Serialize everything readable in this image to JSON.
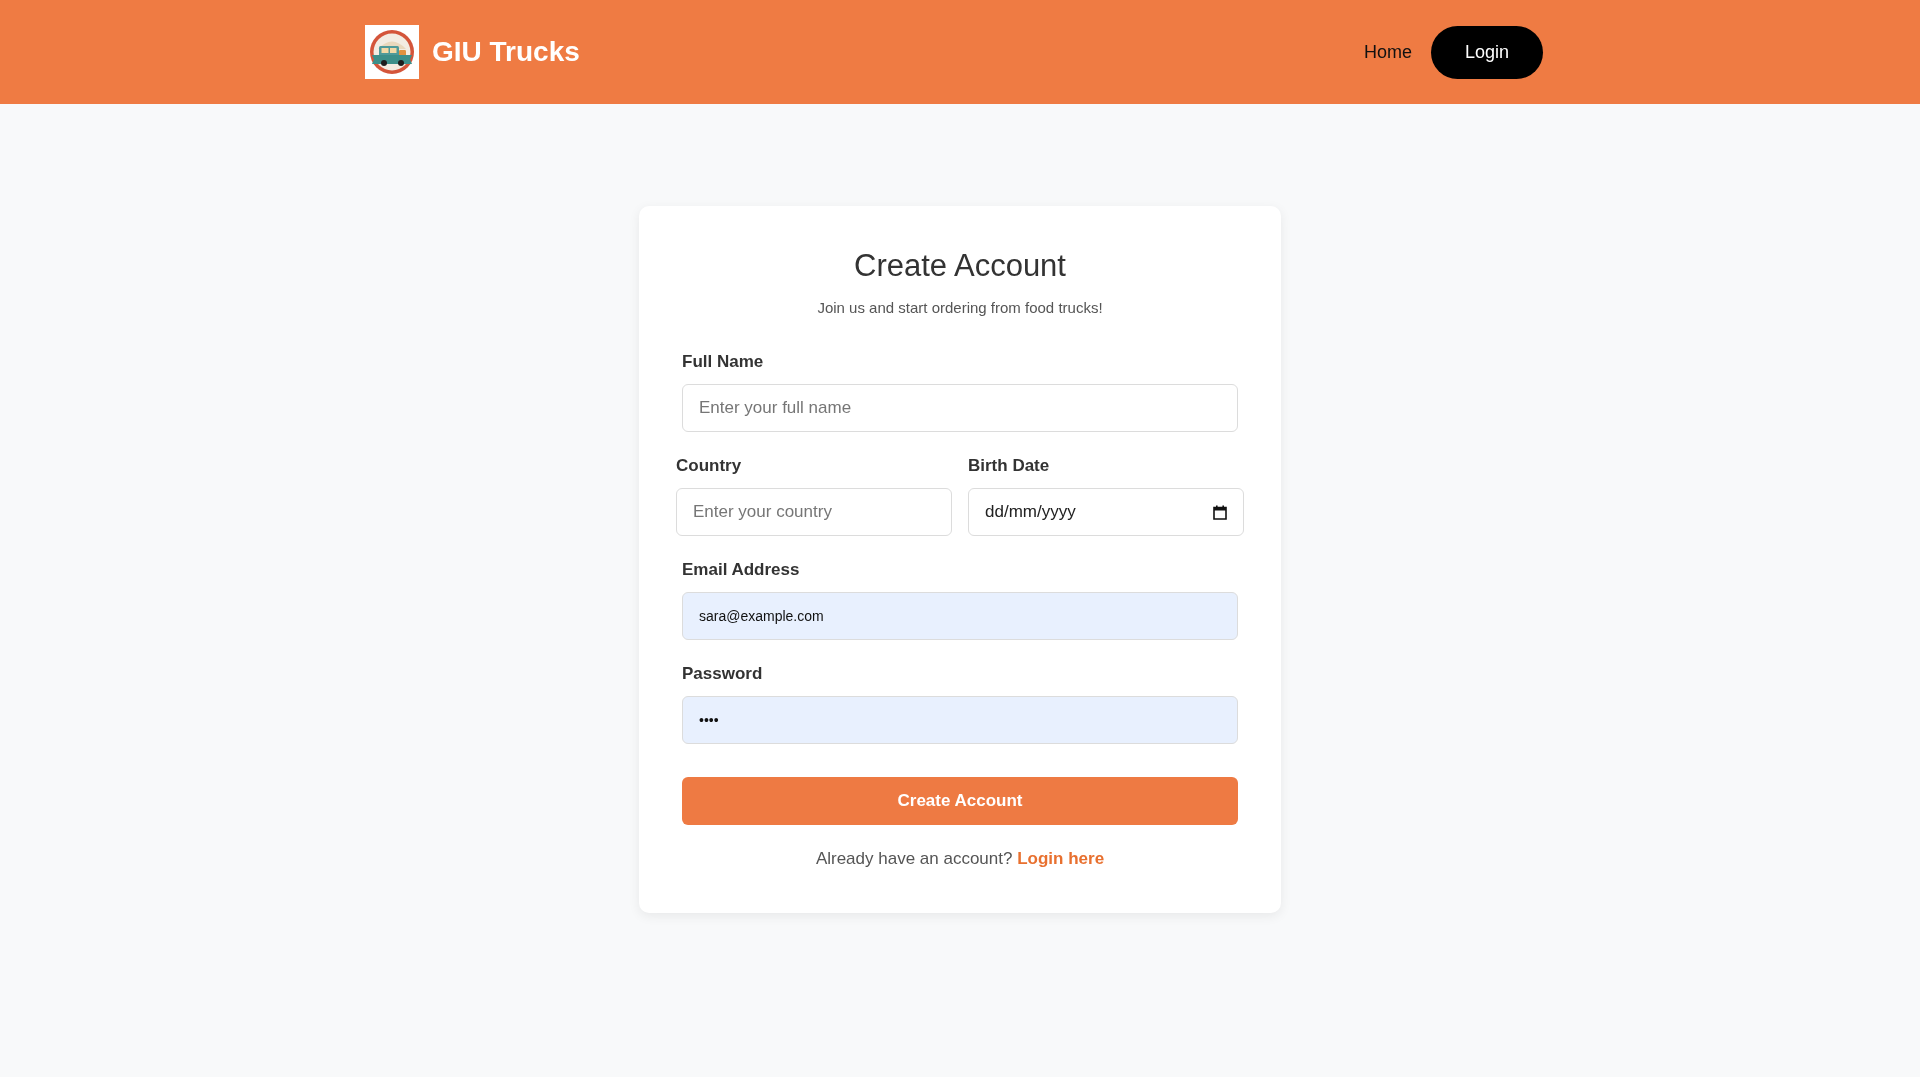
{
  "header": {
    "brand": "GIU Trucks",
    "nav": [
      {
        "label": "Home",
        "kind": "link"
      },
      {
        "label": "Login",
        "kind": "button"
      }
    ]
  },
  "form": {
    "title": "Create Account",
    "subtitle": "Join us and start ordering from food trucks!",
    "rows": [
      {
        "fields": [
          {
            "kind": "text",
            "label": "Full Name",
            "placeholder": "Enter your full name"
          }
        ]
      },
      {
        "fields": [
          {
            "kind": "text",
            "label": "Country",
            "placeholder": "Enter your country"
          },
          {
            "kind": "date",
            "label": "Birth Date",
            "placeholder": "dd/mm/yyyy"
          }
        ]
      },
      {
        "fields": [
          {
            "kind": "email",
            "label": "Email Address",
            "value": "sara@example.com",
            "autofilled": true
          }
        ]
      },
      {
        "fields": [
          {
            "kind": "password",
            "label": "Password",
            "value": "••••",
            "autofilled": true
          }
        ]
      }
    ],
    "submit": {
      "label": "Create Account"
    },
    "footer": {
      "text": "Already have an account?",
      "link": "Login here"
    }
  }
}
